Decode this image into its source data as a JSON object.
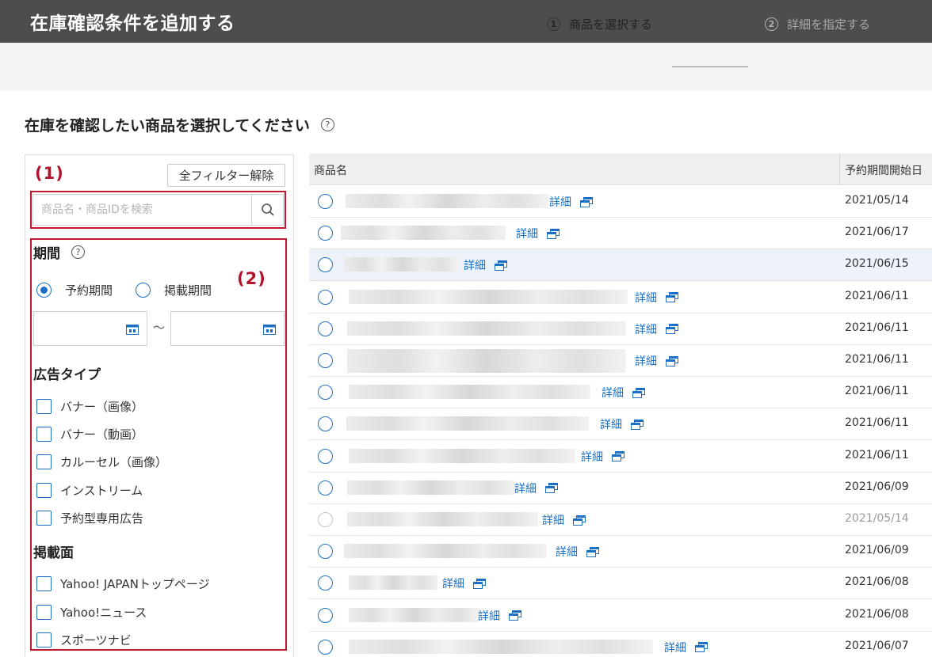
{
  "header": {
    "title": "在庫確認条件を追加する"
  },
  "steps": [
    {
      "num": "1",
      "label": "商品を選択する"
    },
    {
      "num": "2",
      "label": "詳細を指定する"
    }
  ],
  "page": {
    "heading": "在庫を確認したい商品を選択してください",
    "help_glyph": "?"
  },
  "filters": {
    "annotation_1": "(1)",
    "annotation_2": "(2)",
    "clear_label": "全フィルター解除",
    "search_placeholder": "商品名・商品IDを検索",
    "period": {
      "title": "期間",
      "options": [
        "予約期間",
        "掲載期間"
      ],
      "selected": 0,
      "range_separator": "～"
    },
    "ad_type": {
      "title": "広告タイプ",
      "options": [
        "バナー（画像）",
        "バナー（動画）",
        "カルーセル（画像）",
        "インストリーム",
        "予約型専用広告"
      ]
    },
    "placement": {
      "title": "掲載面",
      "options": [
        "Yahoo! JAPANトップページ",
        "Yahoo!ニュース",
        "スポーツナビ"
      ]
    }
  },
  "table": {
    "columns": [
      "商品名",
      "予約期間開始日"
    ],
    "detail_label": "詳細",
    "rows": [
      {
        "date": "2021/05/14"
      },
      {
        "date": "2021/06/17"
      },
      {
        "date": "2021/06/15",
        "highlighted": true
      },
      {
        "date": "2021/06/11"
      },
      {
        "date": "2021/06/11"
      },
      {
        "date": "2021/06/11"
      },
      {
        "date": "2021/06/11"
      },
      {
        "date": "2021/06/11"
      },
      {
        "date": "2021/06/11"
      },
      {
        "date": "2021/06/09"
      },
      {
        "date": "2021/05/14",
        "disabled": true
      },
      {
        "date": "2021/06/09"
      },
      {
        "date": "2021/06/08"
      },
      {
        "date": "2021/06/08"
      },
      {
        "date": "2021/06/07"
      }
    ]
  },
  "colors": {
    "accent": "#1a6fc4",
    "annotation": "#c0182f",
    "header_bg": "#4d4d4d"
  }
}
